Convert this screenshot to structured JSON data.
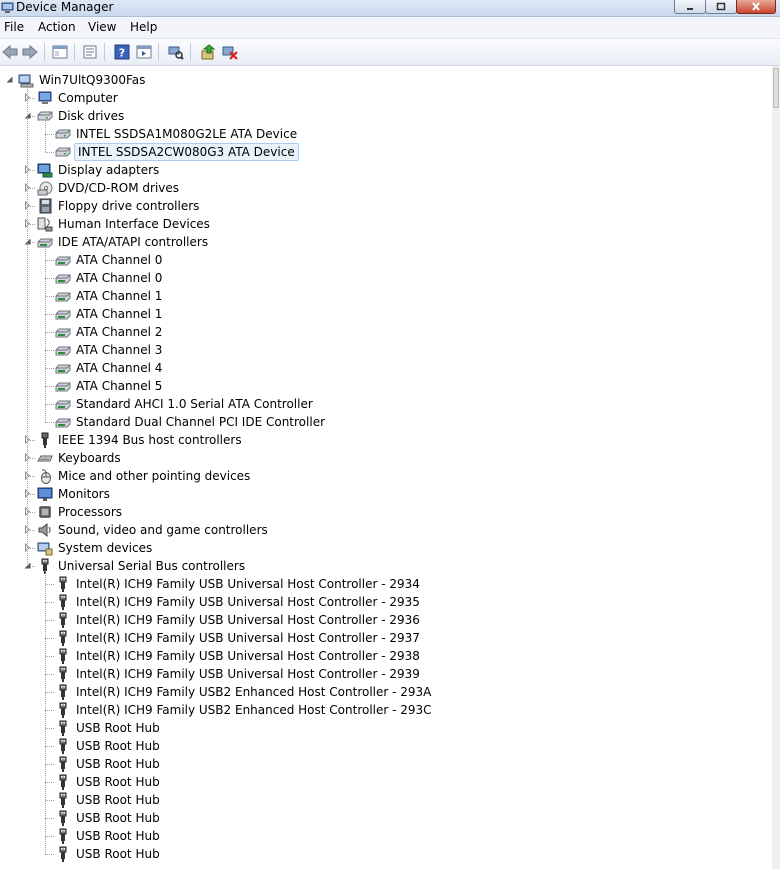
{
  "window": {
    "title": "Device Manager"
  },
  "menu": [
    "File",
    "Action",
    "View",
    "Help"
  ],
  "toolbar": [
    "back",
    "forward",
    "up-one-level",
    "show-hide-console-tree",
    "help",
    "action-pane",
    "scan-hardware-changes",
    "update-driver",
    "uninstall"
  ],
  "tree": {
    "root": "Win7UltQ9300Fas",
    "categories": [
      {
        "label": "Computer",
        "icon": "computer-icon",
        "expanded": false
      },
      {
        "label": "Disk drives",
        "icon": "disk-drive-icon",
        "expanded": true,
        "children": [
          "INTEL SSDSA1M080G2LE ATA Device",
          "INTEL SSDSA2CW080G3 ATA Device"
        ],
        "selected": 1,
        "child_icon": "disk-drive-icon"
      },
      {
        "label": "Display adapters",
        "icon": "display-adapter-icon",
        "expanded": false
      },
      {
        "label": "DVD/CD-ROM drives",
        "icon": "dvd-drive-icon",
        "expanded": false
      },
      {
        "label": "Floppy drive controllers",
        "icon": "floppy-controller-icon",
        "expanded": false
      },
      {
        "label": "Human Interface Devices",
        "icon": "hid-icon",
        "expanded": false
      },
      {
        "label": "IDE ATA/ATAPI controllers",
        "icon": "ide-controller-icon",
        "expanded": true,
        "children": [
          "ATA Channel 0",
          "ATA Channel 0",
          "ATA Channel 1",
          "ATA Channel 1",
          "ATA Channel 2",
          "ATA Channel 3",
          "ATA Channel 4",
          "ATA Channel 5",
          "Standard AHCI 1.0 Serial ATA Controller",
          "Standard Dual Channel PCI IDE Controller"
        ],
        "child_icon": "ide-controller-icon"
      },
      {
        "label": "IEEE 1394 Bus host controllers",
        "icon": "ieee1394-icon",
        "expanded": false
      },
      {
        "label": "Keyboards",
        "icon": "keyboard-icon",
        "expanded": false
      },
      {
        "label": "Mice and other pointing devices",
        "icon": "mouse-icon",
        "expanded": false
      },
      {
        "label": "Monitors",
        "icon": "monitor-icon",
        "expanded": false
      },
      {
        "label": "Processors",
        "icon": "processor-icon",
        "expanded": false
      },
      {
        "label": "Sound, video and game controllers",
        "icon": "sound-icon",
        "expanded": false
      },
      {
        "label": "System devices",
        "icon": "system-devices-icon",
        "expanded": false
      },
      {
        "label": "Universal Serial Bus controllers",
        "icon": "usb-icon",
        "expanded": true,
        "children": [
          "Intel(R) ICH9 Family USB Universal Host Controller - 2934",
          "Intel(R) ICH9 Family USB Universal Host Controller - 2935",
          "Intel(R) ICH9 Family USB Universal Host Controller - 2936",
          "Intel(R) ICH9 Family USB Universal Host Controller - 2937",
          "Intel(R) ICH9 Family USB Universal Host Controller - 2938",
          "Intel(R) ICH9 Family USB Universal Host Controller - 2939",
          "Intel(R) ICH9 Family USB2 Enhanced Host Controller - 293A",
          "Intel(R) ICH9 Family USB2 Enhanced Host Controller - 293C",
          "USB Root Hub",
          "USB Root Hub",
          "USB Root Hub",
          "USB Root Hub",
          "USB Root Hub",
          "USB Root Hub",
          "USB Root Hub",
          "USB Root Hub"
        ],
        "child_icon": "usb-icon"
      }
    ]
  },
  "colors": {
    "selection_bg": "#eaf3fc",
    "selection_border": "#a9cdee",
    "close_button": "#c8452c"
  }
}
